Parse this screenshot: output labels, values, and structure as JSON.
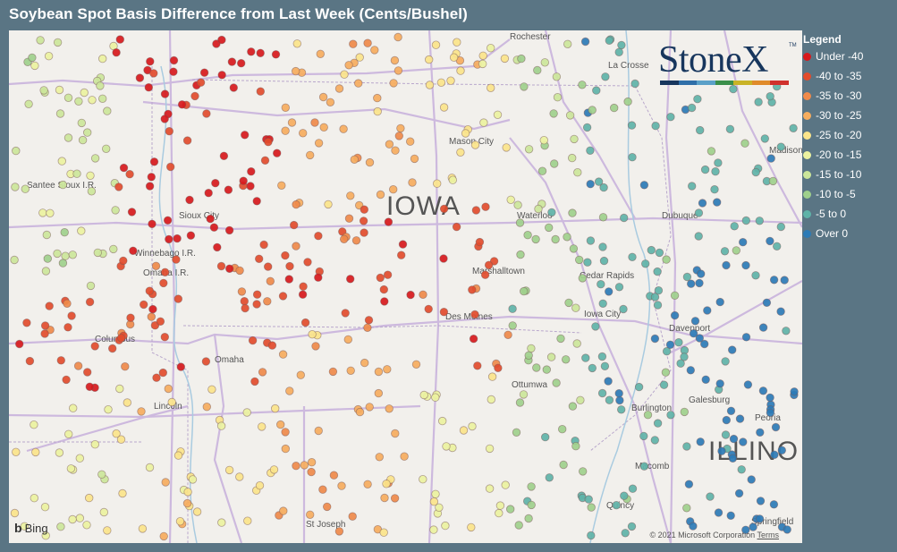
{
  "title": "Soybean Spot Basis Difference from Last Week (Cents/Bushel)",
  "legend": {
    "title": "Legend",
    "items": [
      {
        "label": "Under -40",
        "color": "#d7191c"
      },
      {
        "label": "-40 to -35",
        "color": "#e24c2c"
      },
      {
        "label": "-35 to -30",
        "color": "#ef8a4a"
      },
      {
        "label": "-30 to -25",
        "color": "#f6ad5e"
      },
      {
        "label": "-25 to -20",
        "color": "#fbe48a"
      },
      {
        "label": "-20 to -15",
        "color": "#ecf2a0"
      },
      {
        "label": "-15 to -10",
        "color": "#cce69a"
      },
      {
        "label": "-10 to -5",
        "color": "#9fd08c"
      },
      {
        "label": "-5 to 0",
        "color": "#5fb3a8"
      },
      {
        "label": "Over 0",
        "color": "#2c7bb6"
      }
    ]
  },
  "logo": {
    "text": "StoneX",
    "tm": "TM",
    "bar_colors": [
      "#17365d",
      "#2f6fa8",
      "#5aa0c8",
      "#3a8f4a",
      "#c9b326",
      "#e08b2a",
      "#d0312d"
    ]
  },
  "map": {
    "state_label_iowa": "IOWA",
    "state_label_illinois": "ILLINO",
    "cities": [
      {
        "name": "Rochester"
      },
      {
        "name": "La Crosse"
      },
      {
        "name": "Sioux City"
      },
      {
        "name": "Mason City"
      },
      {
        "name": "Waterloo"
      },
      {
        "name": "Dubuque"
      },
      {
        "name": "Madison"
      },
      {
        "name": "Santee Sioux I.R."
      },
      {
        "name": "Winnebago I.R."
      },
      {
        "name": "Omaha I.R."
      },
      {
        "name": "Marshalltown"
      },
      {
        "name": "Cedar Rapids"
      },
      {
        "name": "Iowa City"
      },
      {
        "name": "Davenport"
      },
      {
        "name": "Columbus"
      },
      {
        "name": "Omaha"
      },
      {
        "name": "Des Moines"
      },
      {
        "name": "Ottumwa"
      },
      {
        "name": "Galesburg"
      },
      {
        "name": "Peoria"
      },
      {
        "name": "Lincoln"
      },
      {
        "name": "Quincy"
      },
      {
        "name": "Springfield"
      },
      {
        "name": "St Joseph"
      },
      {
        "name": "Macomb"
      },
      {
        "name": "Burlington"
      }
    ],
    "bing_label": "Bing",
    "attribution": "© 2021 Microsoft Corporation",
    "terms_label": "Terms"
  }
}
